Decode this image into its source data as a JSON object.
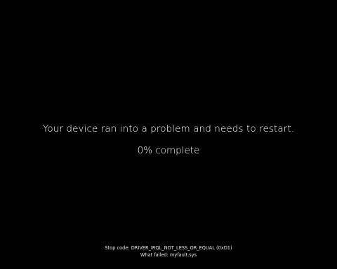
{
  "screen": {
    "background_color": "#000000",
    "text_color": "#ffffff",
    "message": "Your device ran into a problem and needs to restart.",
    "progress_text": "0% complete",
    "progress_percent": 0
  },
  "details": {
    "stop_code": "Stop code: DRIVER_IRQL_NOT_LESS_OR_EQUAL (0xD1)",
    "what_failed": "What failed: myfault.sys"
  }
}
